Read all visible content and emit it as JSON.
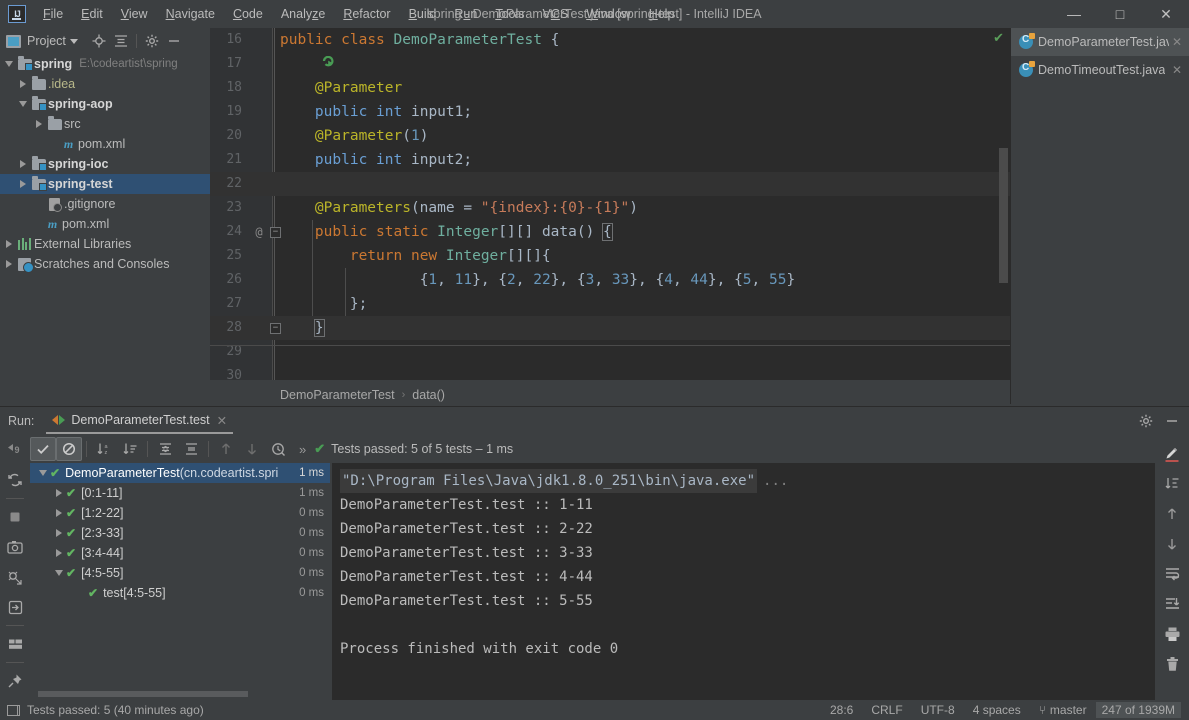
{
  "window": {
    "title": "spring - DemoParameterTest.java [spring-test] - IntelliJ IDEA",
    "logo": "IJ",
    "minimize": "—",
    "maximize": "□",
    "close": "✕"
  },
  "menu": [
    {
      "label": "File"
    },
    {
      "label": "Edit"
    },
    {
      "label": "View"
    },
    {
      "label": "Navigate"
    },
    {
      "label": "Code"
    },
    {
      "label": "Analyze"
    },
    {
      "label": "Refactor"
    },
    {
      "label": "Build"
    },
    {
      "label": "Run"
    },
    {
      "label": "Tools"
    },
    {
      "label": "VCS"
    },
    {
      "label": "Window"
    },
    {
      "label": "Help"
    }
  ],
  "project_panel": {
    "title": "Project",
    "tree": [
      {
        "label": "spring",
        "path": "E:\\codeartist\\spring",
        "icon": "module-folder-icon",
        "indent": 0,
        "expanded": true,
        "bold": true
      },
      {
        "label": ".idea",
        "icon": "folder-icon",
        "indent": 1,
        "expanded": false,
        "bold": false
      },
      {
        "label": "spring-aop",
        "icon": "module-folder-icon",
        "indent": 1,
        "expanded": true,
        "bold": true
      },
      {
        "label": "src",
        "icon": "folder-icon",
        "indent": 2,
        "expanded": false,
        "bold": false
      },
      {
        "label": "pom.xml",
        "icon": "maven-icon",
        "indent": 2,
        "expanded": null,
        "bold": false
      },
      {
        "label": "spring-ioc",
        "icon": "module-folder-icon",
        "indent": 1,
        "expanded": false,
        "bold": true
      },
      {
        "label": "spring-test",
        "icon": "module-folder-icon",
        "indent": 1,
        "expanded": false,
        "bold": true,
        "selected": true
      },
      {
        "label": ".gitignore",
        "icon": "gitignore-icon",
        "indent": 2,
        "expanded": null,
        "bold": false
      },
      {
        "label": "pom.xml",
        "icon": "maven-icon",
        "indent": 1,
        "expanded": null,
        "bold": false
      },
      {
        "label": "External Libraries",
        "icon": "libraries-icon",
        "indent": 0,
        "expanded": false,
        "bold": false
      },
      {
        "label": "Scratches and Consoles",
        "icon": "scratches-icon",
        "indent": 0,
        "expanded": false,
        "bold": false
      }
    ]
  },
  "editor_tabs": [
    {
      "label": "DemoParameterTest.java",
      "active": true,
      "close": "✕"
    },
    {
      "label": "DemoTimeoutTest.java",
      "active": false,
      "close": "✕"
    }
  ],
  "editor": {
    "lines": [
      {
        "num": "16",
        "gutter": "run",
        "text": "public class DemoParameterTest {"
      },
      {
        "num": "17",
        "text": ""
      },
      {
        "num": "18",
        "text": "    @Parameter"
      },
      {
        "num": "19",
        "text": "    public int input1;"
      },
      {
        "num": "20",
        "text": "    @Parameter(1)"
      },
      {
        "num": "21",
        "text": "    public int input2;"
      },
      {
        "num": "22",
        "text": ""
      },
      {
        "num": "23",
        "text": "    @Parameters(name = \"{index}:{0}-{1}\")"
      },
      {
        "num": "24",
        "gutter": "@",
        "fold": "−",
        "text": "    public static Integer[][] data() {"
      },
      {
        "num": "25",
        "text": "        return new Integer[][]{"
      },
      {
        "num": "26",
        "text": "                {1, 11}, {2, 22}, {3, 33}, {4, 44}, {5, 55}"
      },
      {
        "num": "27",
        "text": "        };"
      },
      {
        "num": "28",
        "fold": "−",
        "text": "    }"
      },
      {
        "num": "29",
        "text": ""
      },
      {
        "num": "30",
        "text": ""
      }
    ],
    "inspection_status": "✔"
  },
  "breadcrumb": {
    "class": "DemoParameterTest",
    "separator": "›",
    "method": "data()"
  },
  "run_panel": {
    "label": "Run:",
    "tab_name": "DemoParameterTest.test",
    "tab_close": "✕",
    "settings_icon": "gear-icon",
    "minimize_icon": "—",
    "toolbar": {
      "chevron": "»",
      "status_check": "✔",
      "status_text": "Tests passed: 5 of 5 tests – 1 ms"
    },
    "test_tree": [
      {
        "label": "DemoParameterTest ",
        "pkg": "(cn.codeartist.spri",
        "time": "1 ms",
        "indent": 0,
        "expanded": true,
        "selected": true
      },
      {
        "label": "[0:1-11]",
        "time": "1 ms",
        "indent": 1,
        "expanded": false
      },
      {
        "label": "[1:2-22]",
        "time": "0 ms",
        "indent": 1,
        "expanded": false
      },
      {
        "label": "[2:3-33]",
        "time": "0 ms",
        "indent": 1,
        "expanded": false
      },
      {
        "label": "[3:4-44]",
        "time": "0 ms",
        "indent": 1,
        "expanded": false
      },
      {
        "label": "[4:5-55]",
        "time": "0 ms",
        "indent": 1,
        "expanded": true
      },
      {
        "label": "test[4:5-55]",
        "time": "0 ms",
        "indent": 2,
        "expanded": null
      }
    ],
    "console": {
      "command": "\"D:\\Program Files\\Java\\jdk1.8.0_251\\bin\\java.exe\"",
      "command_ellipsis": "...",
      "output": [
        "DemoParameterTest.test :: 1-11",
        "DemoParameterTest.test :: 2-22",
        "DemoParameterTest.test :: 3-33",
        "DemoParameterTest.test :: 4-44",
        "DemoParameterTest.test :: 5-55",
        "",
        "Process finished with exit code 0"
      ]
    }
  },
  "statusbar": {
    "message": "Tests passed: 5 (40 minutes ago)",
    "position": "28:6",
    "line_sep": "CRLF",
    "encoding": "UTF-8",
    "indent": "4 spaces",
    "branch": "master",
    "memory": "247 of 1939M"
  },
  "colors": {
    "accent_blue": "#3592c4",
    "success_green": "#499c54",
    "selection": "#2f5073",
    "panel_bg": "#3c3f41",
    "editor_bg": "#2b2b2b"
  }
}
